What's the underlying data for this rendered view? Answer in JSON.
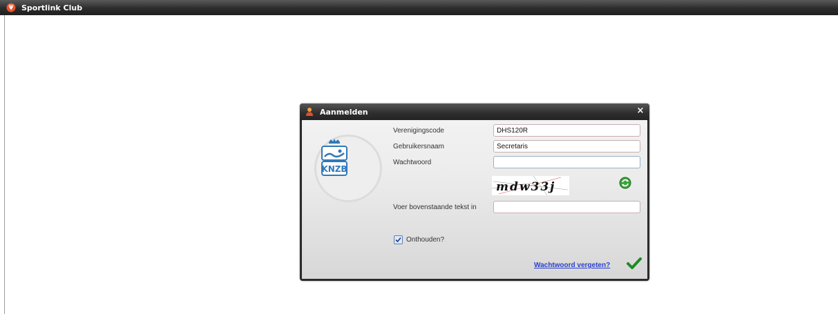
{
  "app": {
    "title": "Sportlink Club",
    "logo_icon": "sportlink-logo-icon"
  },
  "dialog": {
    "title": "Aanmelden",
    "title_icon": "user-icon",
    "close_label": "×",
    "logo": {
      "name": "knzb-logo-icon",
      "text": "KNZB"
    },
    "fields": {
      "club_code": {
        "label": "Verenigingscode",
        "value": "DHS120R"
      },
      "username": {
        "label": "Gebruikersnaam",
        "value": "Secretaris"
      },
      "password": {
        "label": "Wachtwoord",
        "value": ""
      },
      "captcha_input": {
        "label": "Voer bovenstaande tekst in",
        "value": ""
      }
    },
    "captcha_text": "mdw33j",
    "refresh_icon": "refresh-icon",
    "remember": {
      "label": "Onthouden?",
      "checked": true
    },
    "forgot_password_link": "Wachtwoord vergeten?",
    "submit_icon": "checkmark-icon"
  }
}
